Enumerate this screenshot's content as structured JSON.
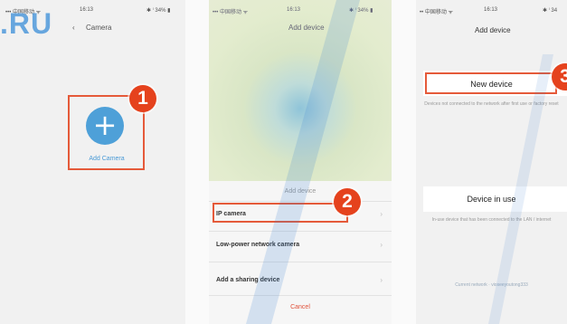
{
  "watermark": ".RU",
  "phone1": {
    "status": {
      "carrier": "••• 中国移动 ᯤ",
      "time": "16:13",
      "battery": "✱ ⁱ 34% ▮"
    },
    "back": "‹",
    "nav_title": "Camera",
    "add_camera_icon": "plus-icon",
    "add_camera_glyph": "+",
    "add_camera_label": "Add Camera",
    "step": "1"
  },
  "phone2": {
    "status": {
      "carrier": "••• 中国移动 ᯤ",
      "time": "16:13",
      "battery": "✱ ⁱ 34% ▮"
    },
    "nav_title": "Add device",
    "sheet": {
      "title": "Add device",
      "items": [
        "IP camera",
        "Low-power network camera",
        "Add a sharing device"
      ],
      "cancel": "Cancel"
    },
    "step": "2"
  },
  "phone3": {
    "status": {
      "carrier": "•• 中国移动 ᯤ",
      "time": "16:13",
      "battery": "✱ ⁱ 34"
    },
    "nav_title": "Add device",
    "new_device": "New device",
    "new_device_hint": "Devices not connected to the network after first use or factory reset",
    "device_in_use": "Device in use",
    "device_in_use_hint": "In-use device that has been connected to the LAN / internet",
    "account": "Current network · vioseeyoutong333",
    "step": "3"
  },
  "colors": {
    "highlight": "#e55a3a",
    "badge": "#e5421d",
    "accent": "#4ea0d8"
  }
}
